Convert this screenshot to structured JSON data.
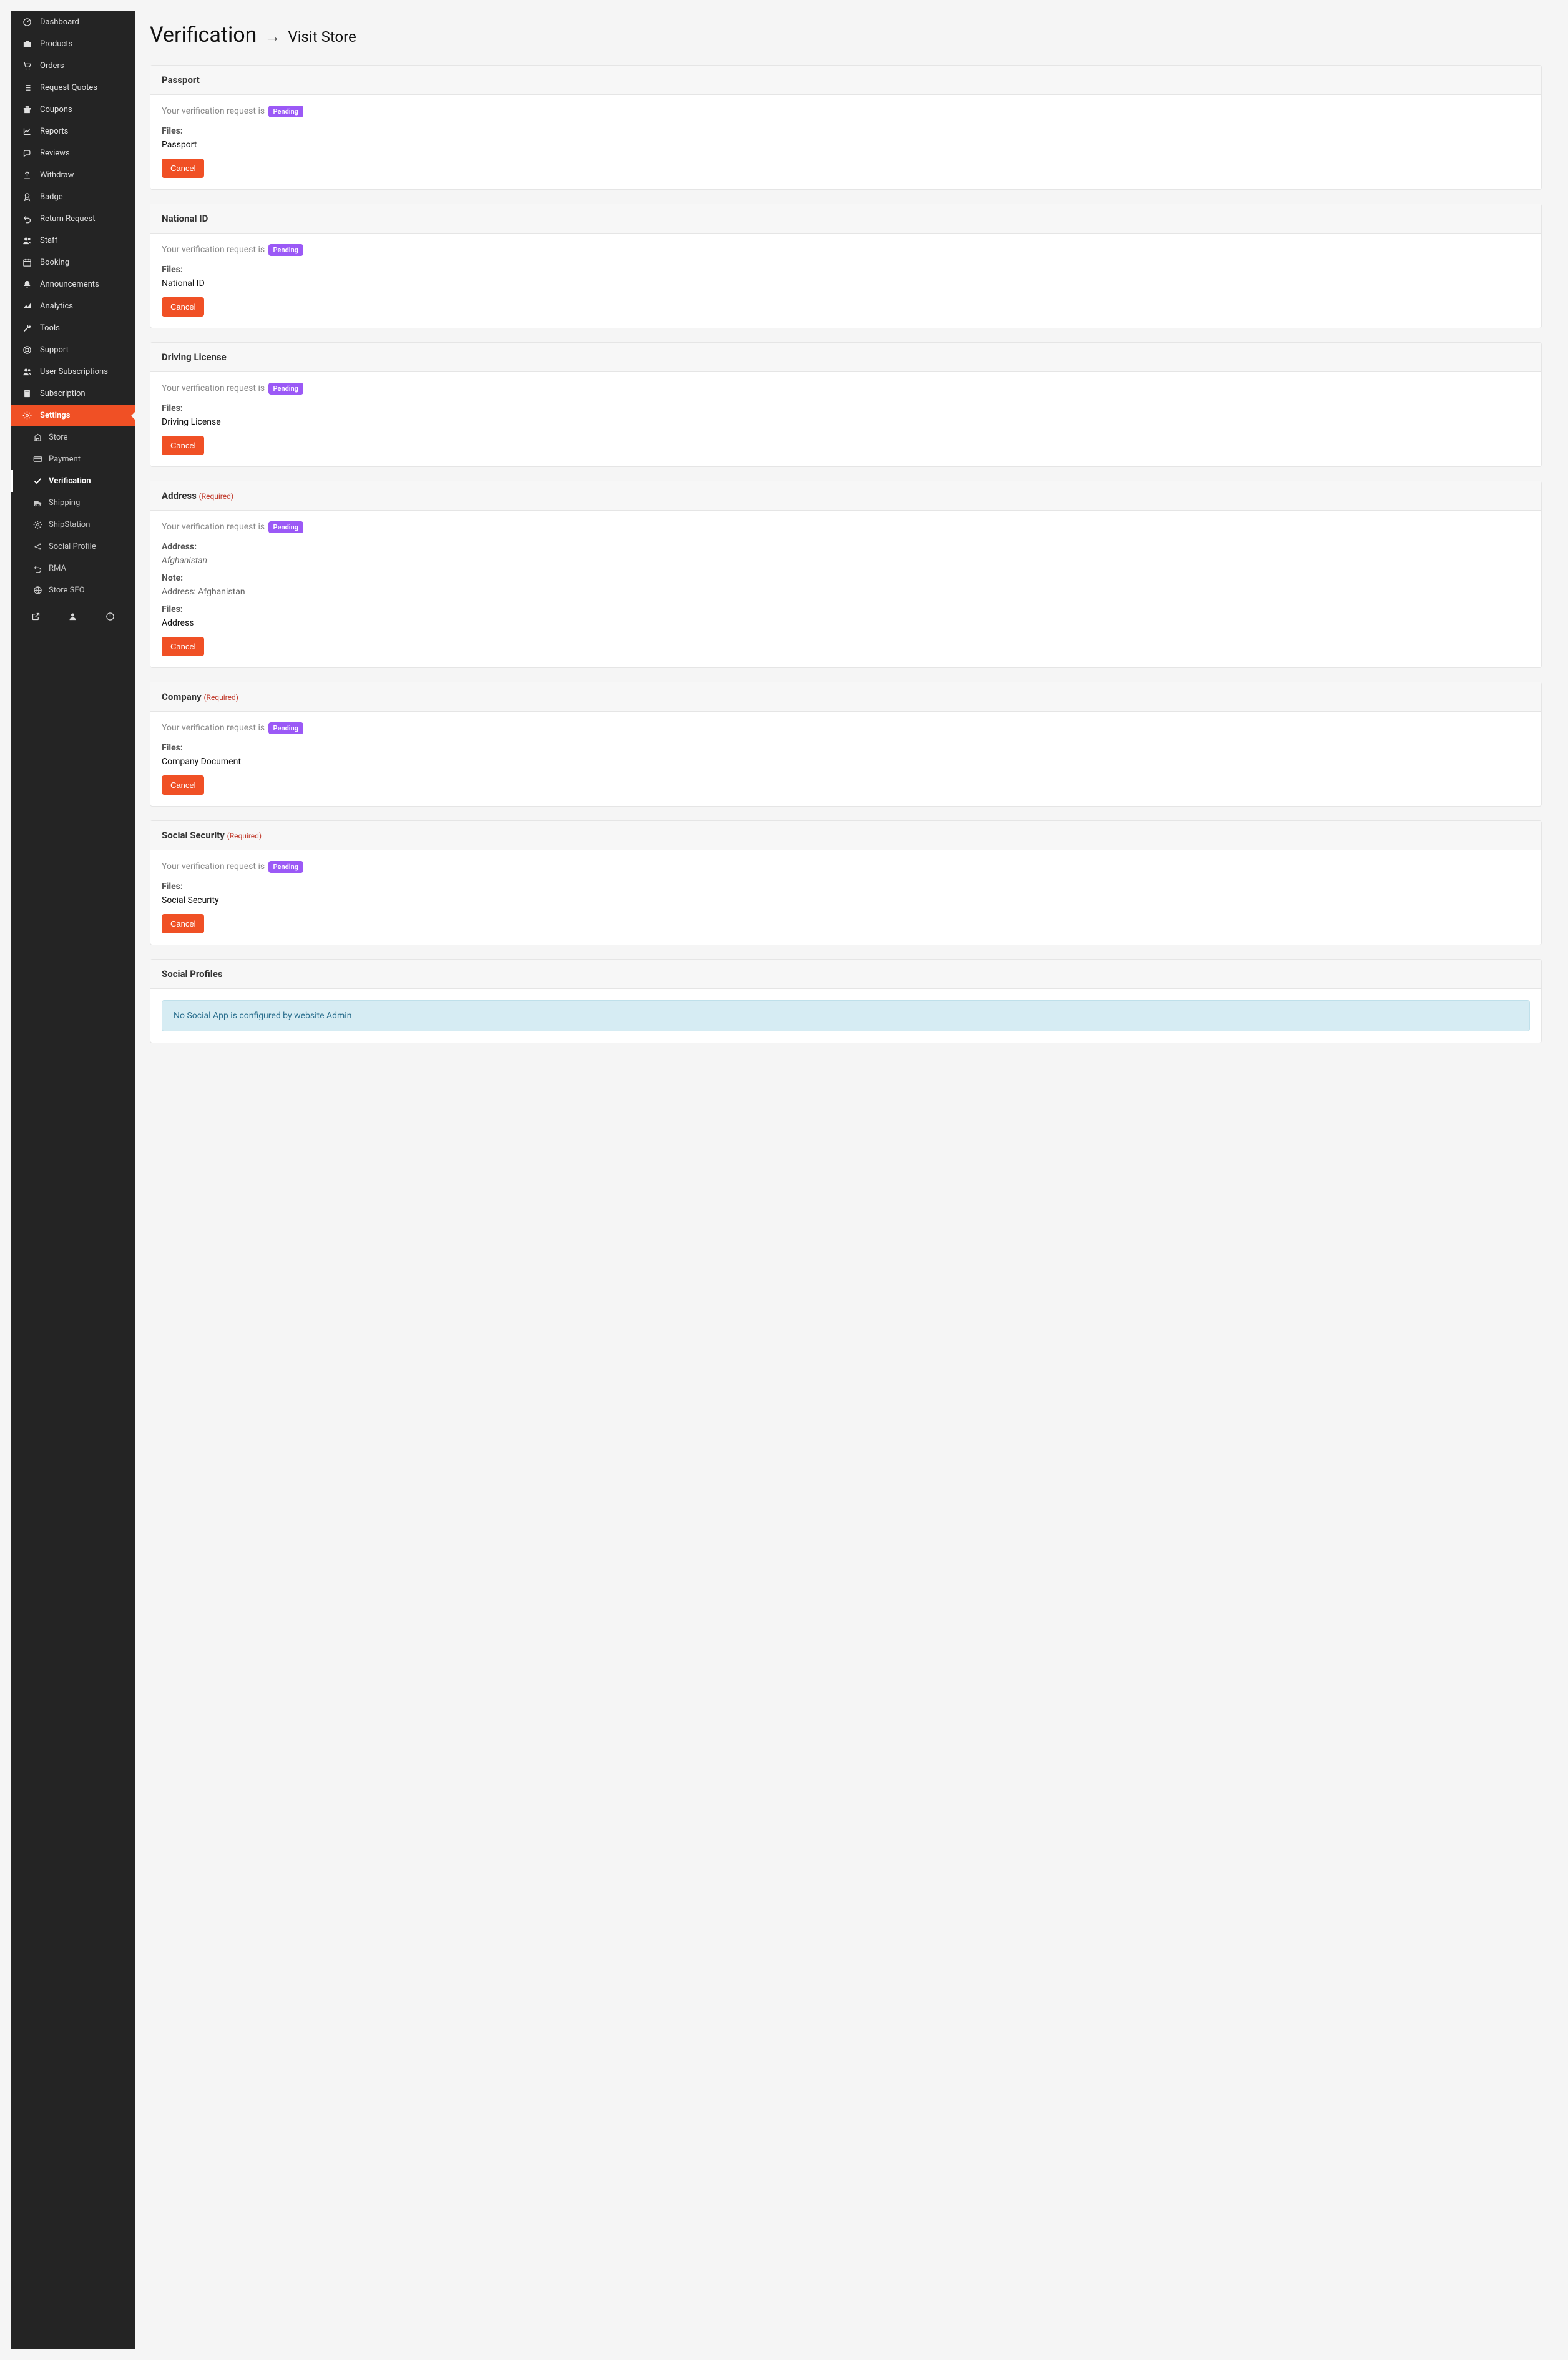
{
  "header": {
    "title": "Verification",
    "visit": "Visit Store"
  },
  "common": {
    "status_prefix": "Your verification request is ",
    "pending": "Pending",
    "files_label": "Files:",
    "cancel": "Cancel",
    "required": "(Required)"
  },
  "sidebar": {
    "items": [
      {
        "label": "Dashboard",
        "icon": "dashboard-icon"
      },
      {
        "label": "Products",
        "icon": "briefcase-icon"
      },
      {
        "label": "Orders",
        "icon": "cart-icon"
      },
      {
        "label": "Request Quotes",
        "icon": "list-icon"
      },
      {
        "label": "Coupons",
        "icon": "gift-icon"
      },
      {
        "label": "Reports",
        "icon": "chart-icon"
      },
      {
        "label": "Reviews",
        "icon": "comments-icon"
      },
      {
        "label": "Withdraw",
        "icon": "upload-icon"
      },
      {
        "label": "Badge",
        "icon": "badge-icon"
      },
      {
        "label": "Return Request",
        "icon": "undo-icon"
      },
      {
        "label": "Staff",
        "icon": "users-icon"
      },
      {
        "label": "Booking",
        "icon": "calendar-icon"
      },
      {
        "label": "Announcements",
        "icon": "bell-icon"
      },
      {
        "label": "Analytics",
        "icon": "area-chart-icon"
      },
      {
        "label": "Tools",
        "icon": "wrench-icon"
      },
      {
        "label": "Support",
        "icon": "life-ring-icon"
      },
      {
        "label": "User Subscriptions",
        "icon": "users-icon"
      },
      {
        "label": "Subscription",
        "icon": "book-icon"
      },
      {
        "label": "Settings",
        "icon": "gear-icon",
        "active": true
      }
    ],
    "submenu": [
      {
        "label": "Store",
        "icon": "building-icon"
      },
      {
        "label": "Payment",
        "icon": "card-icon"
      },
      {
        "label": "Verification",
        "icon": "check-icon",
        "active": true
      },
      {
        "label": "Shipping",
        "icon": "truck-icon"
      },
      {
        "label": "ShipStation",
        "icon": "gear-icon"
      },
      {
        "label": "Social Profile",
        "icon": "share-icon"
      },
      {
        "label": "RMA",
        "icon": "undo-icon"
      },
      {
        "label": "Store SEO",
        "icon": "globe-icon"
      }
    ]
  },
  "cards": [
    {
      "title": "Passport",
      "file": "Passport"
    },
    {
      "title": "National ID",
      "file": "National ID"
    },
    {
      "title": "Driving License",
      "file": "Driving License"
    },
    {
      "title": "Address",
      "required": true,
      "file": "Address",
      "address": "Afghanistan",
      "note": "Address: Afghanistan"
    },
    {
      "title": "Company",
      "required": true,
      "file": "Company Document"
    },
    {
      "title": "Social Security",
      "required": true,
      "file": "Social Security"
    }
  ],
  "social": {
    "title": "Social Profiles",
    "message": "No Social App is configured by website Admin"
  },
  "labels": {
    "address": "Address:",
    "note": "Note:"
  }
}
